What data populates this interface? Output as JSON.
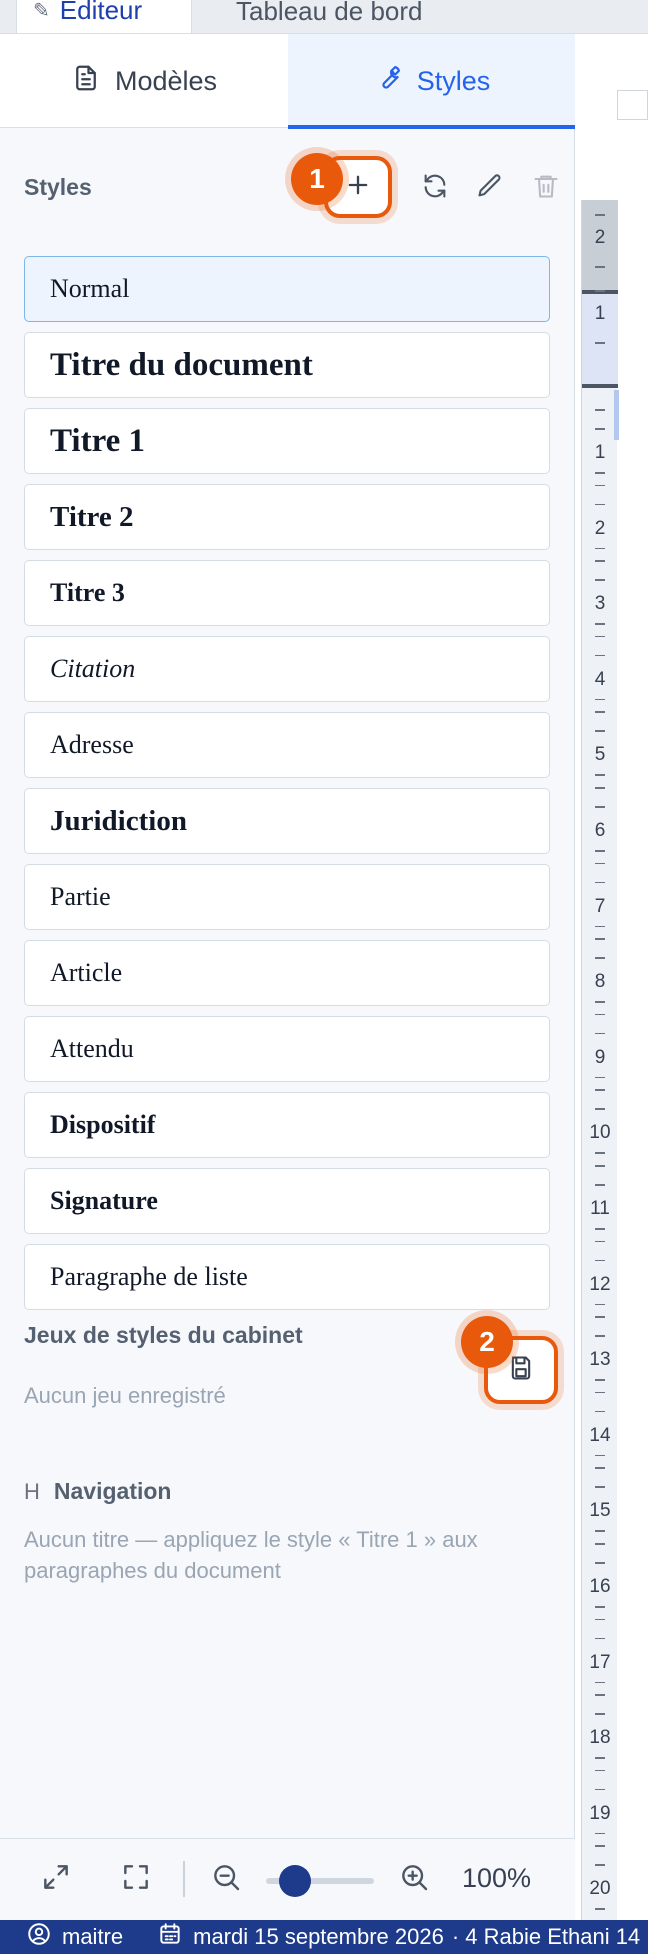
{
  "top_tabs": {
    "editor": "Éditeur",
    "dashboard": "Tableau de bord"
  },
  "panel_tabs": {
    "models": "Modèles",
    "styles": "Styles"
  },
  "styles_section": {
    "title": "Styles",
    "badge_1": "1",
    "items": [
      {
        "label": "Normal"
      },
      {
        "label": "Titre du document"
      },
      {
        "label": "Titre 1"
      },
      {
        "label": "Titre 2"
      },
      {
        "label": "Titre 3"
      },
      {
        "label": "Citation"
      },
      {
        "label": "Adresse"
      },
      {
        "label": "Juridiction"
      },
      {
        "label": "Partie"
      },
      {
        "label": "Article"
      },
      {
        "label": "Attendu"
      },
      {
        "label": "Dispositif"
      },
      {
        "label": "Signature"
      },
      {
        "label": "Paragraphe de liste"
      }
    ]
  },
  "style_sets": {
    "title": "Jeux de styles du cabinet",
    "empty": "Aucun jeu enregistré",
    "badge_2": "2"
  },
  "navigation": {
    "icon_label": "H",
    "title": "Navigation",
    "empty": "Aucun titre — appliquez le style « Titre 1 » aux paragraphes du document"
  },
  "zoom": {
    "value": "100%",
    "level": 0.25
  },
  "status_bar": {
    "user": "maitre",
    "date": "mardi 15 septembre 2026",
    "hijri": "· 4 Rabie Ethani 14"
  },
  "ruler": {
    "top_numbers": [
      "2",
      "1"
    ],
    "numbers": [
      "1",
      "2",
      "3",
      "4",
      "5",
      "6",
      "7",
      "8",
      "9",
      "10",
      "11",
      "12",
      "13",
      "14",
      "15",
      "16",
      "17",
      "18",
      "19",
      "20"
    ]
  },
  "colors": {
    "accent": "#2563eb",
    "highlight": "#e8590c",
    "status_bg": "#1e3a8a"
  }
}
